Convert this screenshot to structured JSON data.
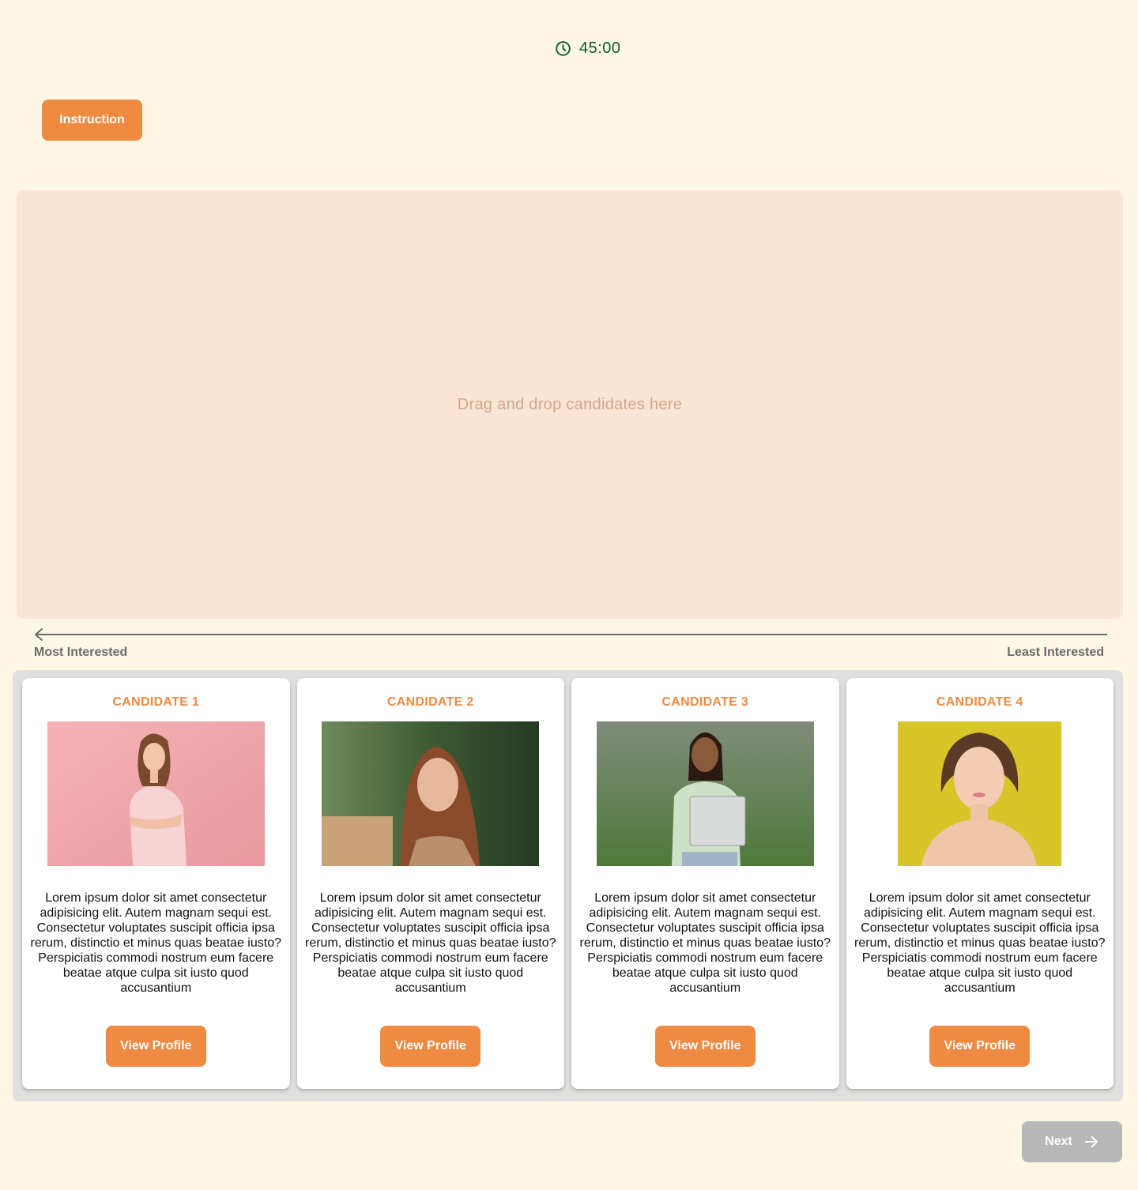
{
  "timer": {
    "icon": "clock-icon",
    "value": "45:00",
    "color": "#0f5a2a"
  },
  "instruction_button": {
    "label": "Instruction"
  },
  "dropzone": {
    "placeholder": "Drag and drop candidates here"
  },
  "scale": {
    "left_label": "Most Interested",
    "right_label": "Least Interested"
  },
  "candidates": [
    {
      "title": "CANDIDATE 1",
      "photo": "woman-pink-background-photo",
      "description": "Lorem ipsum dolor sit amet consectetur adipisicing elit. Autem magnam sequi est. Consectetur voluptates suscipit officia ipsa rerum, distinctio et minus quas beatae iusto? Perspiciatis commodi nostrum eum facere beatae atque culpa sit iusto quod accusantium",
      "button_label": "View Profile"
    },
    {
      "title": "CANDIDATE 2",
      "photo": "woman-outdoor-portrait-photo",
      "description": "Lorem ipsum dolor sit amet consectetur adipisicing elit. Autem magnam sequi est. Consectetur voluptates suscipit officia ipsa rerum, distinctio et minus quas beatae iusto? Perspiciatis commodi nostrum eum facere beatae atque culpa sit iusto quod accusantium",
      "button_label": "View Profile"
    },
    {
      "title": "CANDIDATE 3",
      "photo": "student-with-notebook-photo",
      "description": "Lorem ipsum dolor sit amet consectetur adipisicing elit. Autem magnam sequi est. Consectetur voluptates suscipit officia ipsa rerum, distinctio et minus quas beatae iusto? Perspiciatis commodi nostrum eum facere beatae atque culpa sit iusto quod accusantium",
      "button_label": "View Profile"
    },
    {
      "title": "CANDIDATE 4",
      "photo": "woman-yellow-background-photo",
      "description": "Lorem ipsum dolor sit amet consectetur adipisicing elit. Autem magnam sequi est. Consectetur voluptates suscipit officia ipsa rerum, distinctio et minus quas beatae iusto? Perspiciatis commodi nostrum eum facere beatae atque culpa sit iusto quod accusantium",
      "button_label": "View Profile"
    }
  ],
  "next_button": {
    "label": "Next",
    "icon": "arrow-right-icon",
    "state": "disabled"
  },
  "colors": {
    "accent": "#ef8a42",
    "background": "#fff7e6",
    "dropzone": "#fae4d6",
    "disabled": "#b8b8b8"
  }
}
